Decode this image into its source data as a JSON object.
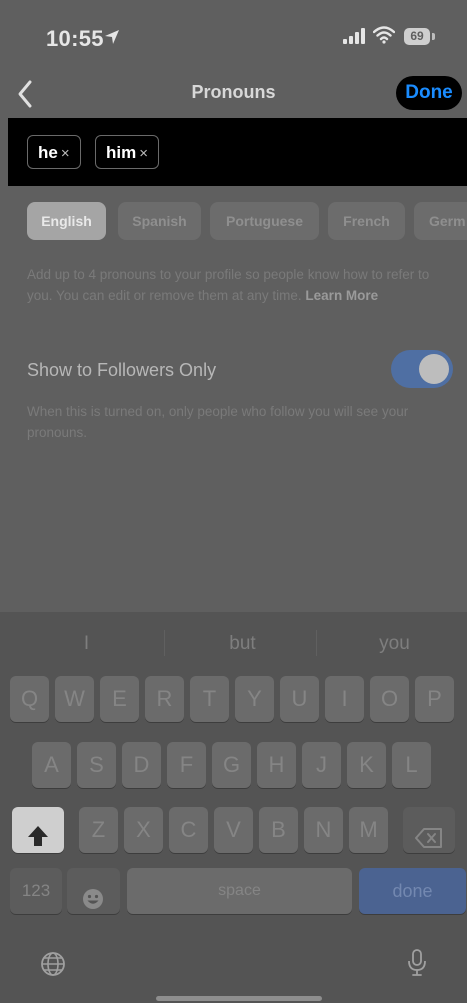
{
  "status_bar": {
    "time": "10:55",
    "battery": "69"
  },
  "nav": {
    "title": "Pronouns",
    "done_label": "Done"
  },
  "chips": [
    {
      "label": "he",
      "remove": "×"
    },
    {
      "label": "him",
      "remove": "×"
    }
  ],
  "languages": [
    "English",
    "Spanish",
    "Portuguese",
    "French",
    "Germ"
  ],
  "help_text": "Add up to 4 pronouns to your profile so people know how to refer to you. You can edit or remove them at any time.",
  "learn_more": "Learn More",
  "toggle": {
    "label": "Show to Followers Only",
    "on": true
  },
  "toggle_help": "When this is turned on, only people who follow you will see your pronouns.",
  "keyboard": {
    "suggestions": [
      "I",
      "but",
      "you"
    ],
    "row1": [
      "Q",
      "W",
      "E",
      "R",
      "T",
      "Y",
      "U",
      "I",
      "O",
      "P"
    ],
    "row2": [
      "A",
      "S",
      "D",
      "F",
      "G",
      "H",
      "J",
      "K",
      "L"
    ],
    "row3": [
      "Z",
      "X",
      "C",
      "V",
      "B",
      "N",
      "M"
    ],
    "num_label": "123",
    "space_label": "space",
    "done_label": "done"
  },
  "colors": {
    "accent": "#1a8cff",
    "toggle_on": "#4f6fa3"
  }
}
